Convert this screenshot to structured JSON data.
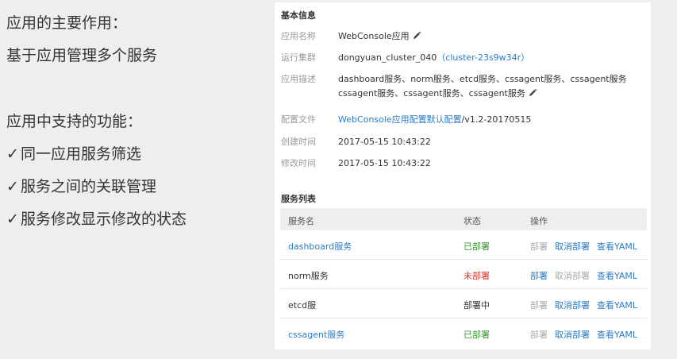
{
  "left": {
    "title": "应用的主要作用：",
    "purpose": "基于应用管理多个服务",
    "features_title": "应用中支持的功能：",
    "check_mark": "✓",
    "features": [
      "同一应用服务筛选",
      "服务之间的关联管理",
      "服务修改显示修改的状态"
    ]
  },
  "basic": {
    "section_title": "基本信息",
    "app_name_label": "应用名称",
    "app_name": "WebConsole应用",
    "cluster_label": "运行集群",
    "cluster_name": "dongyuan_cluster_040",
    "cluster_id_open": "（",
    "cluster_id": "cluster-23s9w34r",
    "cluster_id_close": "）",
    "desc_label": "应用描述",
    "desc_line1": "dashboard服务、norm服务、etcd服务、cssagent服务、cssagent服务",
    "desc_line2": "cssagent服务、cssagent服务、cssagent服务",
    "config_label": "配置文件",
    "config_link": "WebConsole应用配置默认配置",
    "config_version": "/v1.2-20170515",
    "created_label": "创建时间",
    "created": "2017-05-15 10:43:22",
    "modified_label": "修改时间",
    "modified": "2017-05-15 10:43:22"
  },
  "services": {
    "section_title": "服务列表",
    "headers": [
      "服务名",
      "状态",
      "操作"
    ],
    "op_deploy": "部署",
    "op_undeploy": "取消部署",
    "op_yaml": "查看YAML",
    "rows": [
      {
        "name": "dashboard服务",
        "status": "已部署"
      },
      {
        "name": "norm服务",
        "status": "未部署"
      },
      {
        "name": "etcd服",
        "status": "部署中"
      },
      {
        "name": "cssagent服务",
        "status": "已部署"
      }
    ]
  },
  "colors": {
    "link": "#2a7cc7",
    "deployed": "#3a9a34",
    "undeployed": "#e5332a",
    "disabled": "#aaaaaa"
  }
}
